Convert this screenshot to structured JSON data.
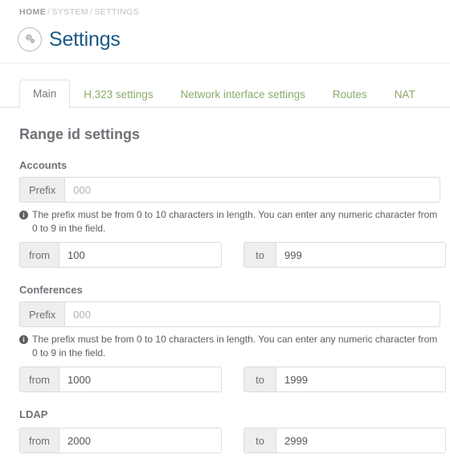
{
  "breadcrumb": {
    "items": [
      "HOME",
      "SYSTEM",
      "SETTINGS"
    ],
    "separator": "/"
  },
  "header": {
    "title": "Settings",
    "icon": "gears-circle-icon"
  },
  "tabs": [
    {
      "label": "Main",
      "active": true
    },
    {
      "label": "H.323 settings",
      "active": false
    },
    {
      "label": "Network interface settings",
      "active": false
    },
    {
      "label": "Routes",
      "active": false
    },
    {
      "label": "NAT",
      "active": false
    }
  ],
  "main": {
    "section_title": "Range id settings",
    "help_text": "The prefix must be from 0 to 10 characters in length. You can enter any numeric character from 0 to 9 in the field.",
    "labels": {
      "prefix": "Prefix",
      "from": "from",
      "to": "to"
    },
    "groups": [
      {
        "name": "Accounts",
        "has_prefix": true,
        "prefix_value": "",
        "prefix_placeholder": "000",
        "has_help": true,
        "from_value": "100",
        "to_value": "999"
      },
      {
        "name": "Conferences",
        "has_prefix": true,
        "prefix_value": "",
        "prefix_placeholder": "000",
        "has_help": true,
        "from_value": "1000",
        "to_value": "1999"
      },
      {
        "name": "LDAP",
        "has_prefix": false,
        "prefix_value": "",
        "prefix_placeholder": "000",
        "has_help": false,
        "from_value": "2000",
        "to_value": "2999"
      }
    ]
  },
  "colors": {
    "title": "#1b5a86",
    "tab_link": "#8aab6b",
    "tab_active": "#777777",
    "heading": "#6e7277",
    "border": "#dcdcdc",
    "addon_bg": "#eeeeee"
  }
}
